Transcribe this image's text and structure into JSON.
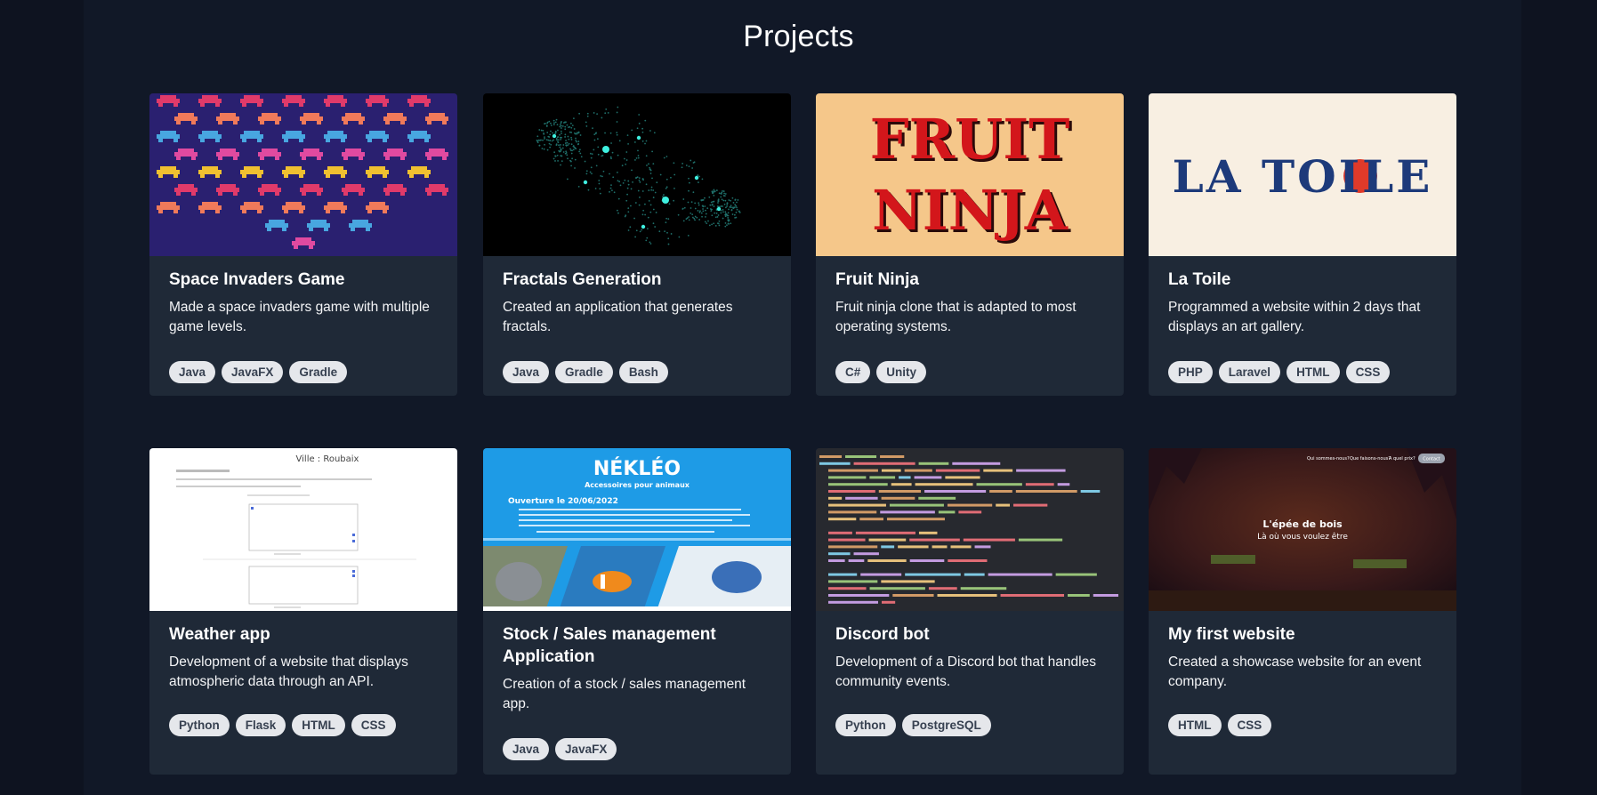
{
  "page": {
    "title": "Projects"
  },
  "colors": {
    "page_bg": "#0e1320",
    "section_bg": "#111827",
    "card_bg": "#1f2937",
    "tag_bg": "#e5e7eb",
    "tag_text": "#374151"
  },
  "projects": [
    {
      "title": "Space Invaders Game",
      "description": "Made a space invaders game with multiple game levels.",
      "tags": [
        "Java",
        "JavaFX",
        "Gradle"
      ],
      "image": "space-invaders-image"
    },
    {
      "title": "Fractals Generation",
      "description": "Created an application that generates fractals.",
      "tags": [
        "Java",
        "Gradle",
        "Bash"
      ],
      "image": "fractal-image"
    },
    {
      "title": "Fruit Ninja",
      "description": "Fruit ninja clone that is adapted to most operating systems.",
      "tags": [
        "C#",
        "Unity"
      ],
      "image": "fruit-ninja-logo-image",
      "image_text": [
        "FRUIT",
        "NINJA"
      ]
    },
    {
      "title": "La Toile",
      "description": "Programmed a website within 2 days that displays an art gallery.",
      "tags": [
        "PHP",
        "Laravel",
        "HTML",
        "CSS"
      ],
      "image": "la-toile-logo-image",
      "image_text": "LA TOILE"
    },
    {
      "title": "Weather app",
      "description": "Development of a website that displays atmospheric data through an API.",
      "tags": [
        "Python",
        "Flask",
        "HTML",
        "CSS"
      ],
      "image": "weather-app-screenshot",
      "image_text": "Ville : Roubaix"
    },
    {
      "title": "Stock / Sales management Application",
      "description": "Creation of a stock / sales management app.",
      "tags": [
        "Java",
        "JavaFX"
      ],
      "image": "nekleo-poster-image",
      "image_text": [
        "NÉKLÉO",
        "Accessoires pour animaux",
        "Ouverture le 20/06/2022"
      ]
    },
    {
      "title": "Discord bot",
      "description": "Development of a Discord bot that handles community events.",
      "tags": [
        "Python",
        "PostgreSQL"
      ],
      "image": "code-screenshot-image"
    },
    {
      "title": "My first website",
      "description": "Created a showcase website for an event company.",
      "tags": [
        "HTML",
        "CSS"
      ],
      "image": "epee-de-bois-screenshot",
      "image_text": [
        "L'épée de bois",
        "Là où vous voulez être",
        "Qui sommes-nous?",
        "Que faisons-nous?",
        "A quel prix?",
        "Contact"
      ]
    }
  ]
}
